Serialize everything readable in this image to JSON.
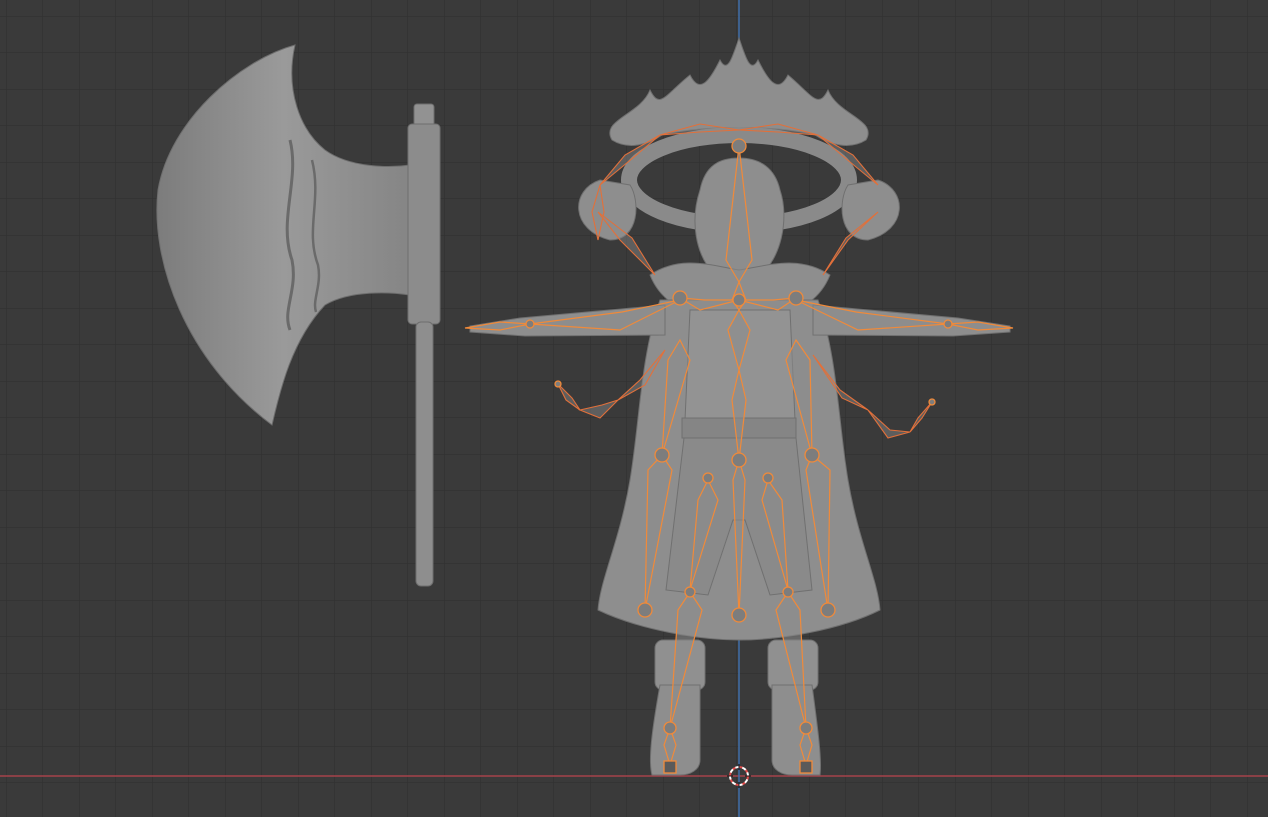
{
  "app": "3D viewport",
  "view": "front-orthographic",
  "grid": {
    "visible": true,
    "minor_color": "#2f2f2f",
    "major_color": "#2a2a2a",
    "background": "#3a3a3a"
  },
  "axes": {
    "x_axis_color": "#a5424b",
    "z_axis_color": "#3f6eaa"
  },
  "scene_objects": [
    {
      "name": "axe",
      "type": "mesh",
      "selected": false,
      "color": "#8e8e8e"
    },
    {
      "name": "character",
      "type": "mesh",
      "selected": false,
      "color": "#8e8e8e"
    },
    {
      "name": "armature",
      "type": "armature",
      "selected": true,
      "color": "#f08a3a"
    }
  ],
  "cursor": {
    "name": "3d-cursor"
  }
}
